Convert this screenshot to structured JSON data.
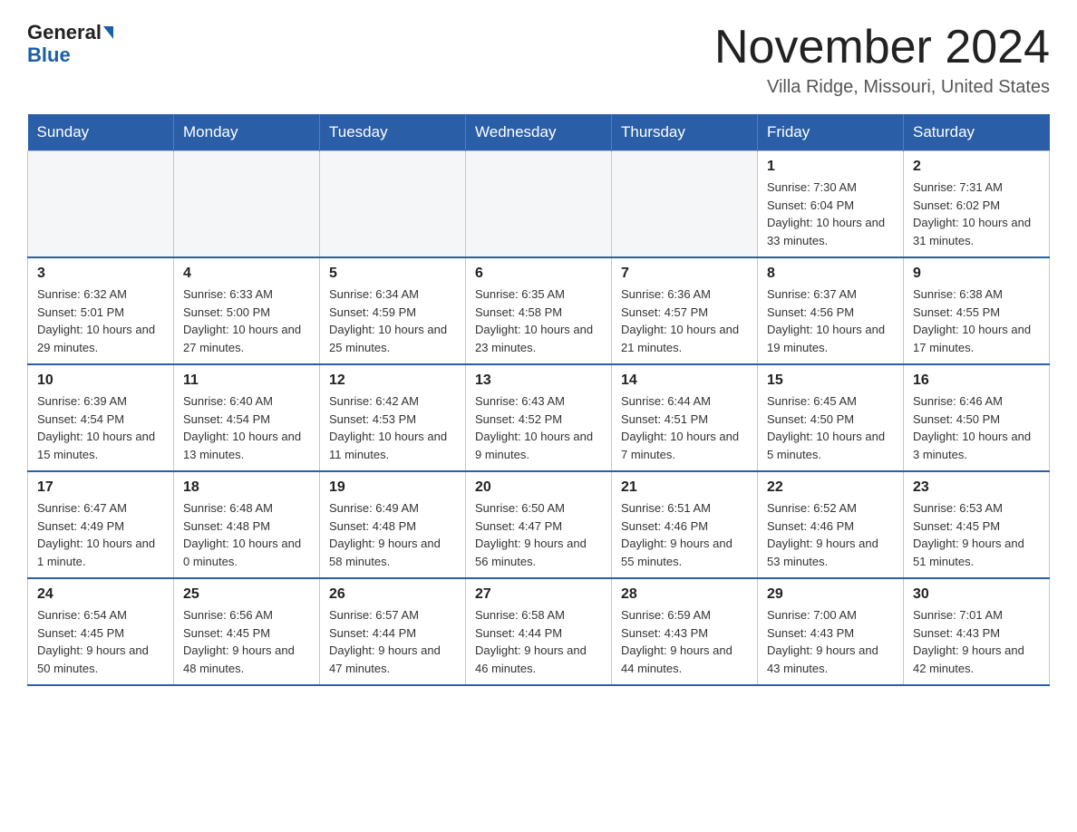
{
  "header": {
    "logo_general": "General",
    "logo_blue": "Blue",
    "month_title": "November 2024",
    "subtitle": "Villa Ridge, Missouri, United States"
  },
  "days_of_week": [
    "Sunday",
    "Monday",
    "Tuesday",
    "Wednesday",
    "Thursday",
    "Friday",
    "Saturday"
  ],
  "weeks": [
    [
      {
        "day": "",
        "info": ""
      },
      {
        "day": "",
        "info": ""
      },
      {
        "day": "",
        "info": ""
      },
      {
        "day": "",
        "info": ""
      },
      {
        "day": "",
        "info": ""
      },
      {
        "day": "1",
        "info": "Sunrise: 7:30 AM\nSunset: 6:04 PM\nDaylight: 10 hours and 33 minutes."
      },
      {
        "day": "2",
        "info": "Sunrise: 7:31 AM\nSunset: 6:02 PM\nDaylight: 10 hours and 31 minutes."
      }
    ],
    [
      {
        "day": "3",
        "info": "Sunrise: 6:32 AM\nSunset: 5:01 PM\nDaylight: 10 hours and 29 minutes."
      },
      {
        "day": "4",
        "info": "Sunrise: 6:33 AM\nSunset: 5:00 PM\nDaylight: 10 hours and 27 minutes."
      },
      {
        "day": "5",
        "info": "Sunrise: 6:34 AM\nSunset: 4:59 PM\nDaylight: 10 hours and 25 minutes."
      },
      {
        "day": "6",
        "info": "Sunrise: 6:35 AM\nSunset: 4:58 PM\nDaylight: 10 hours and 23 minutes."
      },
      {
        "day": "7",
        "info": "Sunrise: 6:36 AM\nSunset: 4:57 PM\nDaylight: 10 hours and 21 minutes."
      },
      {
        "day": "8",
        "info": "Sunrise: 6:37 AM\nSunset: 4:56 PM\nDaylight: 10 hours and 19 minutes."
      },
      {
        "day": "9",
        "info": "Sunrise: 6:38 AM\nSunset: 4:55 PM\nDaylight: 10 hours and 17 minutes."
      }
    ],
    [
      {
        "day": "10",
        "info": "Sunrise: 6:39 AM\nSunset: 4:54 PM\nDaylight: 10 hours and 15 minutes."
      },
      {
        "day": "11",
        "info": "Sunrise: 6:40 AM\nSunset: 4:54 PM\nDaylight: 10 hours and 13 minutes."
      },
      {
        "day": "12",
        "info": "Sunrise: 6:42 AM\nSunset: 4:53 PM\nDaylight: 10 hours and 11 minutes."
      },
      {
        "day": "13",
        "info": "Sunrise: 6:43 AM\nSunset: 4:52 PM\nDaylight: 10 hours and 9 minutes."
      },
      {
        "day": "14",
        "info": "Sunrise: 6:44 AM\nSunset: 4:51 PM\nDaylight: 10 hours and 7 minutes."
      },
      {
        "day": "15",
        "info": "Sunrise: 6:45 AM\nSunset: 4:50 PM\nDaylight: 10 hours and 5 minutes."
      },
      {
        "day": "16",
        "info": "Sunrise: 6:46 AM\nSunset: 4:50 PM\nDaylight: 10 hours and 3 minutes."
      }
    ],
    [
      {
        "day": "17",
        "info": "Sunrise: 6:47 AM\nSunset: 4:49 PM\nDaylight: 10 hours and 1 minute."
      },
      {
        "day": "18",
        "info": "Sunrise: 6:48 AM\nSunset: 4:48 PM\nDaylight: 10 hours and 0 minutes."
      },
      {
        "day": "19",
        "info": "Sunrise: 6:49 AM\nSunset: 4:48 PM\nDaylight: 9 hours and 58 minutes."
      },
      {
        "day": "20",
        "info": "Sunrise: 6:50 AM\nSunset: 4:47 PM\nDaylight: 9 hours and 56 minutes."
      },
      {
        "day": "21",
        "info": "Sunrise: 6:51 AM\nSunset: 4:46 PM\nDaylight: 9 hours and 55 minutes."
      },
      {
        "day": "22",
        "info": "Sunrise: 6:52 AM\nSunset: 4:46 PM\nDaylight: 9 hours and 53 minutes."
      },
      {
        "day": "23",
        "info": "Sunrise: 6:53 AM\nSunset: 4:45 PM\nDaylight: 9 hours and 51 minutes."
      }
    ],
    [
      {
        "day": "24",
        "info": "Sunrise: 6:54 AM\nSunset: 4:45 PM\nDaylight: 9 hours and 50 minutes."
      },
      {
        "day": "25",
        "info": "Sunrise: 6:56 AM\nSunset: 4:45 PM\nDaylight: 9 hours and 48 minutes."
      },
      {
        "day": "26",
        "info": "Sunrise: 6:57 AM\nSunset: 4:44 PM\nDaylight: 9 hours and 47 minutes."
      },
      {
        "day": "27",
        "info": "Sunrise: 6:58 AM\nSunset: 4:44 PM\nDaylight: 9 hours and 46 minutes."
      },
      {
        "day": "28",
        "info": "Sunrise: 6:59 AM\nSunset: 4:43 PM\nDaylight: 9 hours and 44 minutes."
      },
      {
        "day": "29",
        "info": "Sunrise: 7:00 AM\nSunset: 4:43 PM\nDaylight: 9 hours and 43 minutes."
      },
      {
        "day": "30",
        "info": "Sunrise: 7:01 AM\nSunset: 4:43 PM\nDaylight: 9 hours and 42 minutes."
      }
    ]
  ]
}
